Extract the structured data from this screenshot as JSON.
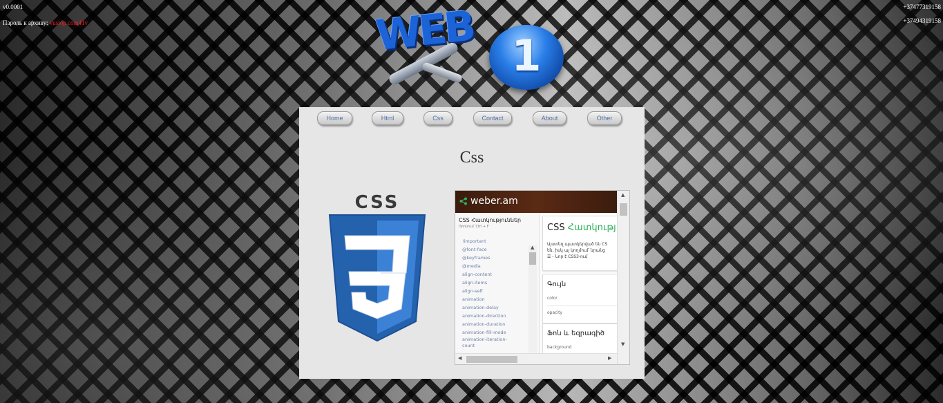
{
  "version": "v0.0001",
  "password": {
    "label": "Пароль к архиву:",
    "value": "vustop.com41v"
  },
  "phones": [
    "+37477319158",
    "+37494319158"
  ],
  "logo": {
    "word": "WEB",
    "number": "1"
  },
  "nav": {
    "items": [
      {
        "label": "Home"
      },
      {
        "label": "Html"
      },
      {
        "label": "Css"
      },
      {
        "label": "Contact"
      },
      {
        "label": "About"
      },
      {
        "label": "Other"
      }
    ]
  },
  "page": {
    "title": "Css"
  },
  "css_logo": {
    "text": "CSS",
    "number": "3"
  },
  "screenshot": {
    "brand": "weber.am",
    "sidebar": {
      "title": "CSS Հատկություններ",
      "hint": "Որոնում՝ Ctrl + F",
      "items": [
        "!important",
        "@font-face",
        "@keyframes",
        "@media",
        "align-content",
        "align-items",
        "align-self",
        "animation",
        "animation-delay",
        "animation-direction",
        "animation-duration",
        "animation-fill-mode",
        "animation-iteration-",
        "count"
      ]
    },
    "card1": {
      "title_plain": "CSS ",
      "title_accent": "Հատկությ",
      "line1": "Այստեղ պատկերված են CS",
      "line2": "են, իսկ այ կողմում՝ նրանց",
      "line3": "☰ - Նոր է CSS3-ում"
    },
    "card2": {
      "title": "Գույն",
      "item1": "color",
      "item2": "opacity"
    },
    "card3": {
      "title": "Ֆոն և եզրագիծ",
      "item1": "background"
    }
  },
  "colors": {
    "password_value": "#ff1a1a",
    "nav_text": "#4f6fa8",
    "panel_bg": "#e6e6e6",
    "css3_blue": "#2462ad",
    "accent_green": "#2db35b"
  }
}
